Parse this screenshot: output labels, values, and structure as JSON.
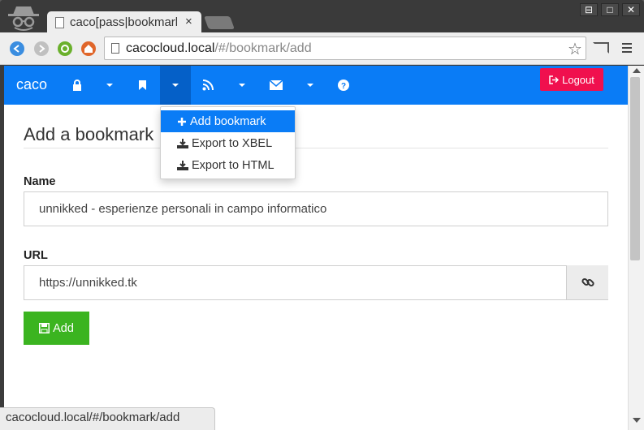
{
  "browser": {
    "tab_title": "caco[pass|bookmark",
    "tab_close": "×",
    "url_host": "cacocloud.local",
    "url_path": "/#/bookmark/add",
    "status_url": "cacocloud.local/#/bookmark/add",
    "window_buttons": [
      "⊟",
      "□",
      "✕"
    ]
  },
  "navbar": {
    "brand": "caco",
    "logout_label": "Logout",
    "accent": "#0a7cf6",
    "logout_color": "#f0104e"
  },
  "dropdown": {
    "items": [
      {
        "label": "Add bookmark",
        "icon": "plus-icon"
      },
      {
        "label": "Export to XBEL",
        "icon": "download-icon"
      },
      {
        "label": "Export to HTML",
        "icon": "download-icon"
      }
    ]
  },
  "form": {
    "heading": "Add a bookmark",
    "name_label": "Name",
    "name_value": "unnikked - esperienze personali in campo informatico",
    "url_label": "URL",
    "url_value": "https://unnikked.tk",
    "add_label": "Add",
    "add_color": "#3bb420"
  }
}
